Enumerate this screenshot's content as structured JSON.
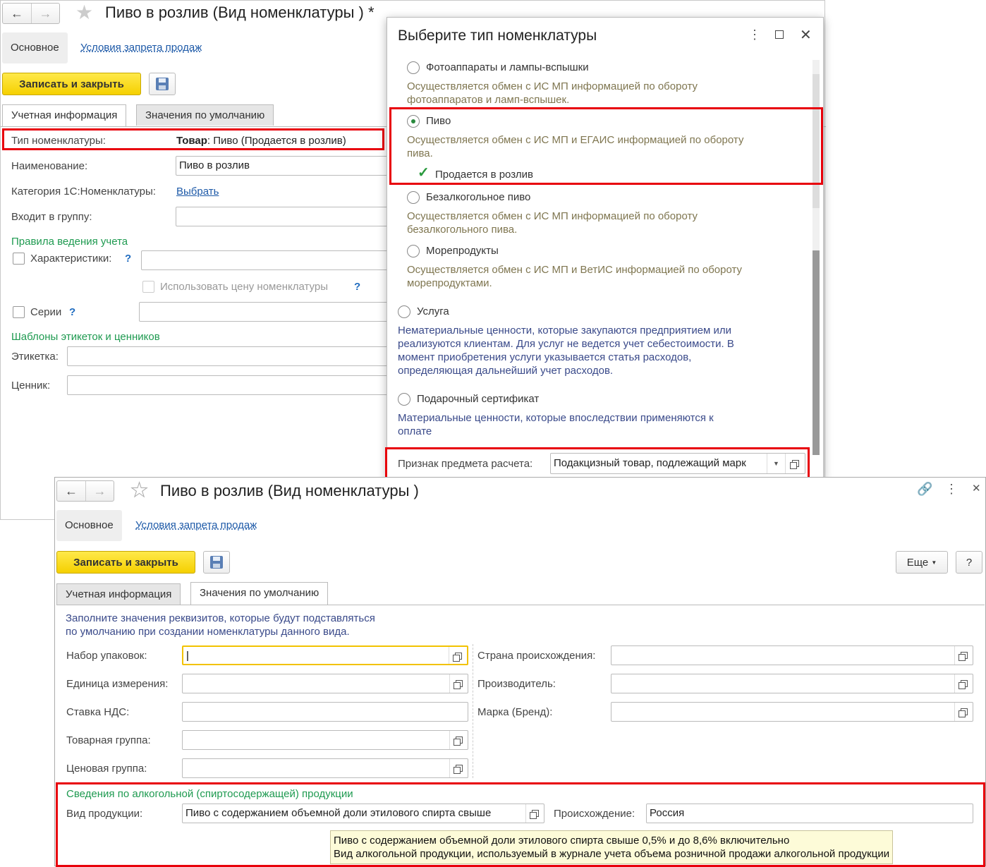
{
  "back_window": {
    "title": "Пиво в розлив (Вид номенклатуры ) *",
    "nav_main": "Основное",
    "nav_link": "Условия запрета продаж",
    "save_close": "Записать и закрыть",
    "tabs": [
      "Учетная информация",
      "Значения по умолчанию"
    ],
    "type_label": "Тип номенклатуры:",
    "type_value_bold": "Товар",
    "type_value_rest": ": Пиво (Продается в розлив)",
    "name_label": "Наименование:",
    "name_value": "Пиво в розлив",
    "category_label": "Категория 1С:Номенклатуры:",
    "category_link": "Выбрать",
    "group_label": "Входит в группу:",
    "rules_heading": "Правила ведения учета",
    "characteristics": "Характеристики:",
    "use_price": "Использовать цену номенклатуры",
    "series": "Серии",
    "help": "?",
    "templates_heading": "Шаблоны этикеток и ценников",
    "label_label": "Этикетка:",
    "price_tag_label": "Ценник:"
  },
  "dialog": {
    "title": "Выберите тип номенклатуры",
    "options": [
      {
        "label": "Фотоаппараты и лампы-вспышки",
        "desc": "Осуществляется обмен с ИС МП информацией по обороту фотоаппаратов и ламп-вспышек.",
        "selected": false
      },
      {
        "label": "Пиво",
        "desc": "Осуществляется обмен с ИС МП и ЕГАИС информацией по обороту пива.",
        "selected": true,
        "checkbox": "Продается в розлив"
      },
      {
        "label": "Безалкогольное пиво",
        "desc": "Осуществляется обмен с ИС МП информацией по обороту безалкогольного пива.",
        "selected": false
      },
      {
        "label": "Морепродукты",
        "desc": "Осуществляется обмен с ИС МП и ВетИС информацией по обороту морепродуктами.",
        "selected": false
      },
      {
        "label": "Услуга",
        "desc": "Нематериальные ценности, которые закупаются предприятием или реализуются клиентам. Для услуг не ведется учет себестоимости. В момент приобретения услуги указывается статья расходов, определяющая дальнейший учет расходов.",
        "selected": false
      },
      {
        "label": "Подарочный сертификат",
        "desc": "Материальные ценности, которые впоследствии применяются к оплате",
        "selected": false
      }
    ],
    "payment_label": "Признак предмета расчета:",
    "payment_value": "Подакцизный товар, подлежащий марк"
  },
  "front_window": {
    "title": "Пиво в розлив (Вид номенклатуры )",
    "nav_main": "Основное",
    "nav_link": "Условия запрета продаж",
    "save_close": "Записать и закрыть",
    "more": "Еще",
    "help": "?",
    "tabs": [
      "Учетная информация",
      "Значения по умолчанию"
    ],
    "intro": "Заполните значения реквизитов, которые будут подставляться\nпо умолчанию при создании номенклатуры данного вида.",
    "left_fields": [
      "Набор упаковок:",
      "Единица измерения:",
      "Ставка НДС:",
      "Товарная группа:",
      "Ценовая группа:"
    ],
    "right_fields": [
      "Страна происхождения:",
      "Производитель:",
      "Марка (Бренд):"
    ],
    "alco_heading": "Сведения по алкогольной (спиртосодержащей) продукции",
    "product_kind_label": "Вид продукции:",
    "product_kind_value": "Пиво с содержанием объемной доли этилового спирта свыше",
    "origin_label": "Происхождение:",
    "origin_value": "Россия",
    "tooltip_line1": "Пиво с содержанием объемной доли этилового спирта свыше 0,5% и до 8,6% включительно",
    "tooltip_line2": "Вид алкогольной продукции, используемый в журнале учета объема розничной продажи алкогольной продукции"
  },
  "colors": {
    "highlight": "#e8000b",
    "accent_button": "#f5d000",
    "group_heading": "#1e9a50",
    "link": "#1e5aa8"
  }
}
